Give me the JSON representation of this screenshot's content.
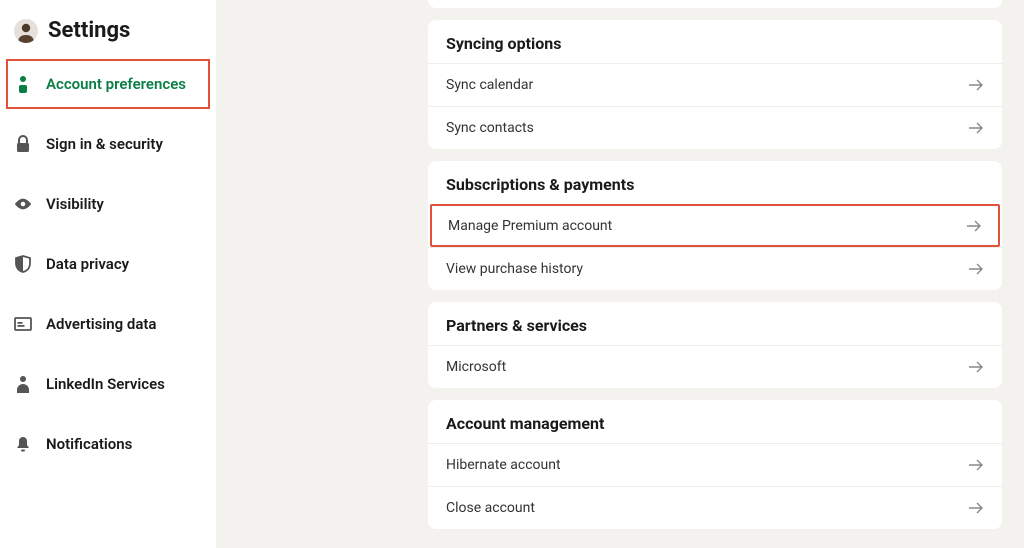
{
  "header": {
    "title": "Settings"
  },
  "sidebar": {
    "items": [
      {
        "label": "Account preferences",
        "icon": "user-icon",
        "active": true
      },
      {
        "label": "Sign in & security",
        "icon": "lock-icon",
        "active": false
      },
      {
        "label": "Visibility",
        "icon": "eye-icon",
        "active": false
      },
      {
        "label": "Data privacy",
        "icon": "shield-icon",
        "active": false
      },
      {
        "label": "Advertising data",
        "icon": "ad-icon",
        "active": false
      },
      {
        "label": "LinkedIn Services",
        "icon": "person-icon",
        "active": false
      },
      {
        "label": "Notifications",
        "icon": "bell-icon",
        "active": false
      }
    ]
  },
  "sections": [
    {
      "title": "Syncing options",
      "rows": [
        {
          "label": "Sync calendar",
          "highlighted": false
        },
        {
          "label": "Sync contacts",
          "highlighted": false
        }
      ]
    },
    {
      "title": "Subscriptions & payments",
      "rows": [
        {
          "label": "Manage Premium account",
          "highlighted": true
        },
        {
          "label": "View purchase history",
          "highlighted": false
        }
      ]
    },
    {
      "title": "Partners & services",
      "rows": [
        {
          "label": "Microsoft",
          "highlighted": false
        }
      ]
    },
    {
      "title": "Account management",
      "rows": [
        {
          "label": "Hibernate account",
          "highlighted": false
        },
        {
          "label": "Close account",
          "highlighted": false
        }
      ]
    }
  ],
  "colors": {
    "accent": "#0a7f44",
    "highlight_outline": "#e0533a"
  }
}
